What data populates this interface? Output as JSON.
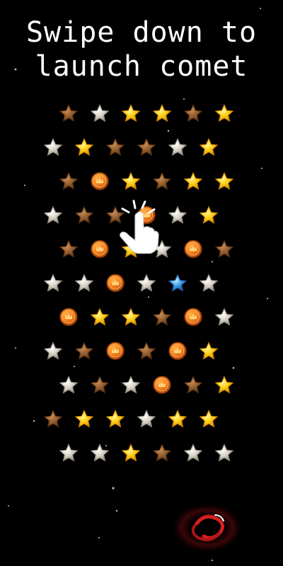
{
  "instruction": {
    "line1": "Swipe down to",
    "line2": "launch comet"
  },
  "colors": {
    "background": "#000000",
    "text": "#ffffff",
    "star_gold": "#ffcc1a",
    "star_silver": "#d9d3c8",
    "star_bronze": "#8a5a30",
    "star_blue": "#2f8fd8",
    "coin": "#e8731c",
    "vortex": "#d41f1f"
  },
  "board": {
    "rows": [
      [
        "bronze",
        "silver",
        "gold",
        "gold",
        "bronze",
        "gold"
      ],
      [
        "silver",
        "gold",
        "bronze",
        "bronze",
        "silver",
        "gold"
      ],
      [
        "bronze",
        "coin",
        "gold",
        "bronze",
        "gold",
        "gold"
      ],
      [
        "silver",
        "bronze",
        "bronze",
        "coin",
        "silver",
        "gold"
      ],
      [
        "bronze",
        "coin",
        "gold",
        "silver",
        "coin",
        "bronze"
      ],
      [
        "silver",
        "silver",
        "coin",
        "silver",
        "blue",
        "silver"
      ],
      [
        "coin",
        "gold",
        "gold",
        "bronze",
        "coin",
        "silver"
      ],
      [
        "silver",
        "bronze",
        "coin",
        "bronze",
        "coin",
        "gold"
      ],
      [
        "silver",
        "bronze",
        "silver",
        "coin",
        "bronze",
        "gold"
      ],
      [
        "bronze",
        "gold",
        "gold",
        "silver",
        "gold",
        "gold"
      ],
      [
        "silver",
        "silver",
        "gold",
        "bronze",
        "silver",
        "silver"
      ]
    ]
  },
  "icons": {
    "hand": "pointing-hand-icon",
    "vortex": "black-hole-icon"
  }
}
